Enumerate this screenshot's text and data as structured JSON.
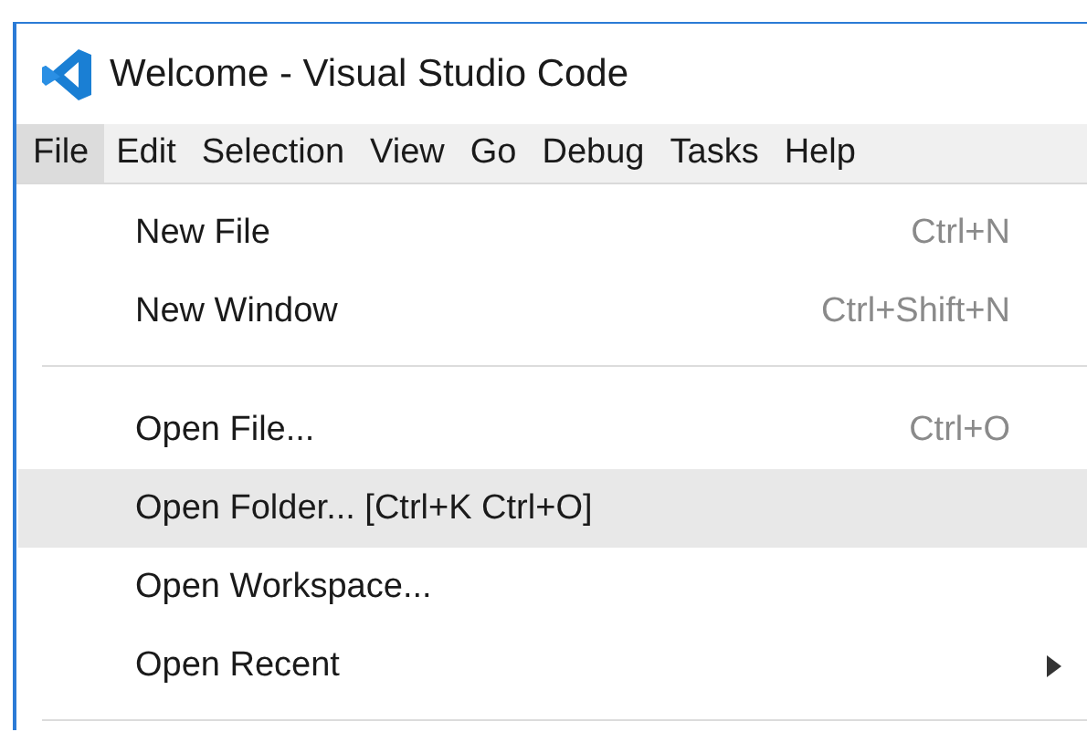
{
  "window": {
    "title": "Welcome - Visual Studio Code"
  },
  "menu_bar": [
    {
      "label": "File",
      "selected": true
    },
    {
      "label": "Edit",
      "selected": false
    },
    {
      "label": "Selection",
      "selected": false
    },
    {
      "label": "View",
      "selected": false
    },
    {
      "label": "Go",
      "selected": false
    },
    {
      "label": "Debug",
      "selected": false
    },
    {
      "label": "Tasks",
      "selected": false
    },
    {
      "label": "Help",
      "selected": false
    }
  ],
  "menu_groups": [
    {
      "items": [
        {
          "label": "New File",
          "shortcut": "Ctrl+N",
          "selected": false,
          "submenu": false
        },
        {
          "label": "New Window",
          "shortcut": "Ctrl+Shift+N",
          "selected": false,
          "submenu": false
        }
      ]
    },
    {
      "items": [
        {
          "label": "Open File...",
          "shortcut": "Ctrl+O",
          "selected": false,
          "submenu": false
        },
        {
          "label": "Open Folder... [Ctrl+K Ctrl+O]",
          "selected": true,
          "submenu": false
        },
        {
          "label": "Open Workspace...",
          "selected": false,
          "submenu": false
        },
        {
          "label": "Open Recent",
          "selected": false,
          "submenu": true
        }
      ]
    }
  ]
}
